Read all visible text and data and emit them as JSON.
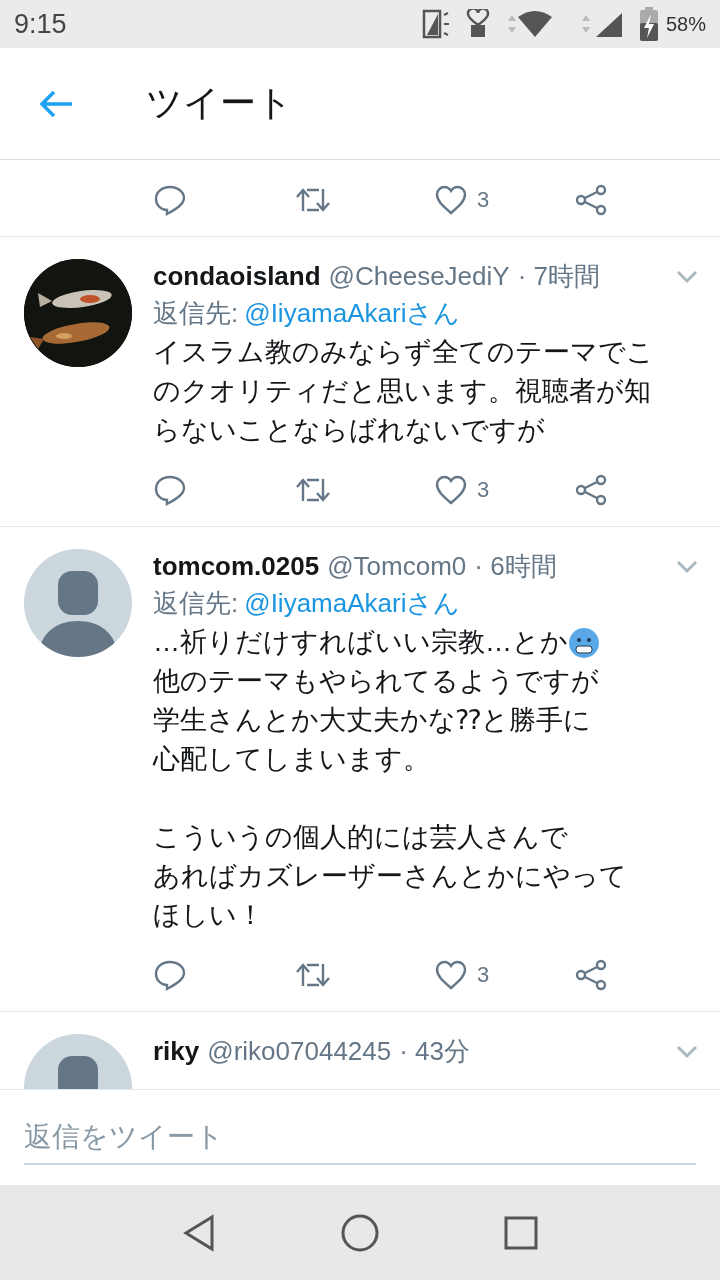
{
  "status_bar": {
    "time": "9:15",
    "battery": "58%"
  },
  "header": {
    "title": "ツイート"
  },
  "tweets": [
    {
      "kind": "actions",
      "like_count": "3"
    },
    {
      "kind": "tweet",
      "avatar": {
        "kind": "picture"
      },
      "name": "condaoisland",
      "handle": "@CheeseJediY",
      "time": "· 7時間",
      "reply_label": "返信先:",
      "reply_to": "@IiyamaAkariさん",
      "paragraphs": [
        {
          "lines": [
            {
              "text": "イスラム教のみならず全てのテーマでこ"
            },
            {
              "text": "のクオリティだと思います。視聴者が知"
            },
            {
              "text": "らないことならばれないですが"
            }
          ]
        }
      ],
      "like_count": "3"
    },
    {
      "kind": "tweet",
      "avatar": {
        "kind": "default"
      },
      "name": "tomcom.0205",
      "handle": "@Tomcom0",
      "time": "· 6時間",
      "reply_label": "返信先:",
      "reply_to": "@IiyamaAkariさん",
      "paragraphs": [
        {
          "lines": [
            {
              "text": "…祈りだけすればいい宗教…とか",
              "emoji": true
            },
            {
              "text": "他のテーマもやられてるようですが"
            },
            {
              "text": "学生さんとか大丈夫かな⁇と勝手に"
            },
            {
              "text": "心配してしまいます。"
            }
          ]
        },
        {
          "lines": [
            {
              "text": "こういうの個人的には芸人さんで"
            },
            {
              "text": "あればカズレーザーさんとかにやって"
            },
            {
              "text": "ほしい！"
            }
          ]
        }
      ],
      "like_count": "3"
    },
    {
      "kind": "tweet",
      "avatar": {
        "kind": "default"
      },
      "name": "riky",
      "handle": "@riko07044245",
      "time": "· 43分"
    }
  ],
  "reply_bar": {
    "placeholder": "返信をツイート"
  }
}
